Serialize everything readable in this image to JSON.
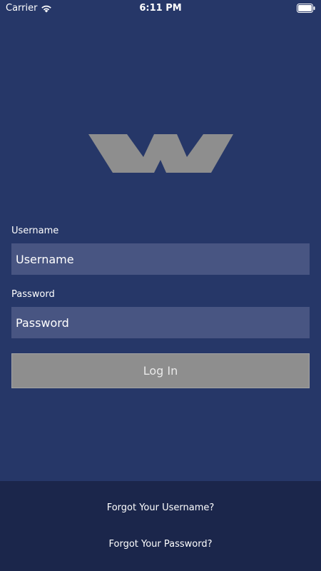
{
  "status_bar": {
    "carrier": "Carrier",
    "time": "6:11 PM"
  },
  "logo": {
    "icon": "w-logo-icon",
    "color": "#8e8e8e"
  },
  "form": {
    "username_label": "Username",
    "username_placeholder": "Username",
    "password_label": "Password",
    "password_placeholder": "Password",
    "login_label": "Log In"
  },
  "footer": {
    "forgot_username": "Forgot Your Username?",
    "forgot_password": "Forgot Your Password?"
  },
  "colors": {
    "background": "#263768",
    "input_background": "#485582",
    "button_background": "#8e8e8e",
    "footer_background": "#1b264b"
  }
}
